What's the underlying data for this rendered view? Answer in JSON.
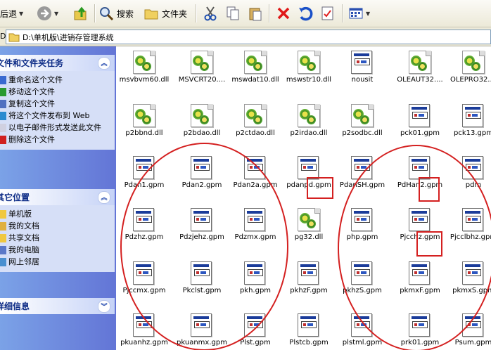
{
  "toolbar": {
    "back_label": "后退",
    "search_label": "搜索",
    "folders_label": "文件夹"
  },
  "address": {
    "prefix": "D",
    "path": "D:\\单机版\\进销存管理系统"
  },
  "tasks_panel": {
    "title": "文件和文件夹任务",
    "items": [
      {
        "label": "重命名这个文件",
        "icon": "rename-icon"
      },
      {
        "label": "移动这个文件",
        "icon": "move-icon"
      },
      {
        "label": "复制这个文件",
        "icon": "copy-icon"
      },
      {
        "label": "将这个文件发布到 Web",
        "icon": "publish-web-icon"
      },
      {
        "label": "以电子邮件形式发送此文件",
        "icon": "email-icon"
      },
      {
        "label": "删除这个文件",
        "icon": "delete-icon"
      }
    ]
  },
  "places_panel": {
    "title": "其它位置",
    "items": [
      {
        "label": "单机版",
        "icon": "folder-icon"
      },
      {
        "label": "我的文档",
        "icon": "documents-icon"
      },
      {
        "label": "共享文档",
        "icon": "shared-folder-icon"
      },
      {
        "label": "我的电脑",
        "icon": "computer-icon"
      },
      {
        "label": "网上邻居",
        "icon": "network-icon"
      }
    ]
  },
  "details_panel": {
    "title": "详细信息"
  },
  "files": [
    {
      "name": "msvbvm60.dll",
      "type": "dll"
    },
    {
      "name": "MSVCRT20....",
      "type": "dll"
    },
    {
      "name": "mswdat10.dll",
      "type": "dll"
    },
    {
      "name": "mswstr10.dll",
      "type": "dll"
    },
    {
      "name": "nousit",
      "type": "gpm"
    },
    {
      "name": "OLEAUT32....",
      "type": "dll"
    },
    {
      "name": "OLEPRO32....",
      "type": "dll"
    },
    {
      "name": "p2bbnd.dll",
      "type": "dll"
    },
    {
      "name": "p2bdao.dll",
      "type": "dll"
    },
    {
      "name": "p2ctdao.dll",
      "type": "dll"
    },
    {
      "name": "p2irdao.dll",
      "type": "dll"
    },
    {
      "name": "p2sodbc.dll",
      "type": "dll"
    },
    {
      "name": "pck01.gpm",
      "type": "gpm"
    },
    {
      "name": "pck13.gpm",
      "type": "gpm"
    },
    {
      "name": "Pdan1.gpm",
      "type": "gpm"
    },
    {
      "name": "Pdan2.gpm",
      "type": "gpm"
    },
    {
      "name": "Pdan2a.gpm",
      "type": "gpm"
    },
    {
      "name": "pdanpd.gpm",
      "type": "gpm"
    },
    {
      "name": "PdanSH.gpm",
      "type": "gpm"
    },
    {
      "name": "PdHan2.gpm",
      "type": "gpm"
    },
    {
      "name": "pdm",
      "type": "gpm"
    },
    {
      "name": "Pdzhz.gpm",
      "type": "gpm"
    },
    {
      "name": "Pdzjehz.gpm",
      "type": "gpm"
    },
    {
      "name": "Pdzmx.gpm",
      "type": "gpm"
    },
    {
      "name": "pg32.dll",
      "type": "dll"
    },
    {
      "name": "php.gpm",
      "type": "gpm"
    },
    {
      "name": "Pjcchz.gpm",
      "type": "gpm"
    },
    {
      "name": "Pjcclbhz.gpm",
      "type": "gpm"
    },
    {
      "name": "Pjccmx.gpm",
      "type": "gpm"
    },
    {
      "name": "Pkclst.gpm",
      "type": "gpm"
    },
    {
      "name": "pkh.gpm",
      "type": "gpm"
    },
    {
      "name": "pkhzF.gpm",
      "type": "gpm"
    },
    {
      "name": "pkhzS.gpm",
      "type": "gpm"
    },
    {
      "name": "pkmxF.gpm",
      "type": "gpm"
    },
    {
      "name": "pkmxS.gpm",
      "type": "gpm"
    },
    {
      "name": "pkuanhz.gpm",
      "type": "gpm"
    },
    {
      "name": "pkuanmx.gpm",
      "type": "gpm"
    },
    {
      "name": "Plst.gpm",
      "type": "gpm"
    },
    {
      "name": "Plstcb.gpm",
      "type": "gpm"
    },
    {
      "name": "plstml.gpm",
      "type": "gpm"
    },
    {
      "name": "prk01.gpm",
      "type": "gpm"
    },
    {
      "name": "Psum.gpm",
      "type": "gpm"
    }
  ],
  "colors": {
    "annotation": "#d42020",
    "sidebar_header_text": "#0c2b86"
  }
}
